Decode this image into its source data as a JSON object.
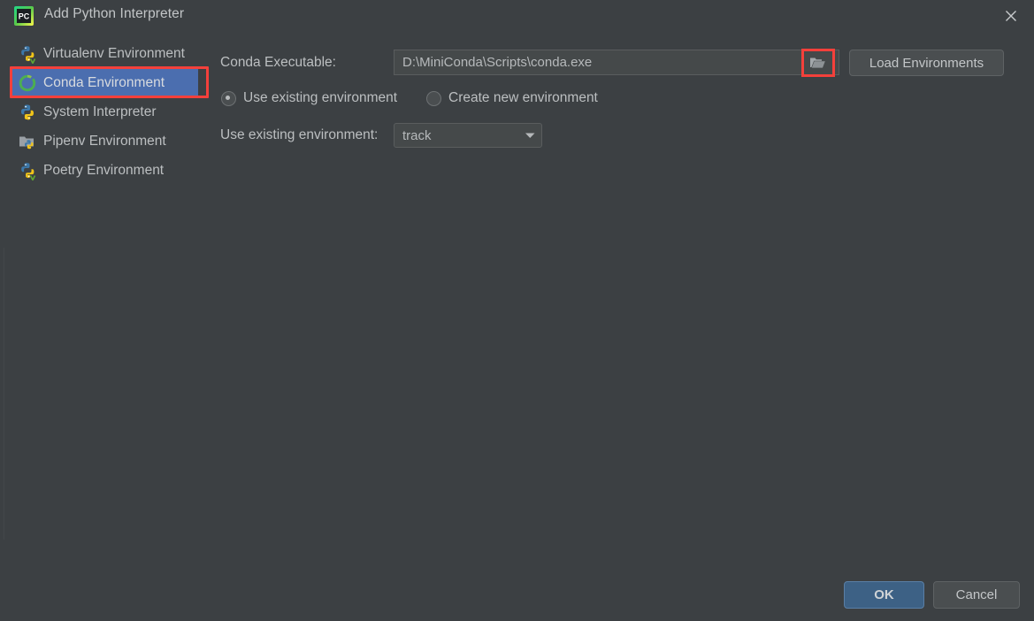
{
  "window": {
    "title": "Add Python Interpreter",
    "app_icon": "pycharm-icon",
    "close_icon": "close-icon"
  },
  "sidebar": {
    "items": [
      {
        "label": "Virtualenv Environment",
        "icon": "python-venv-icon",
        "selected": false
      },
      {
        "label": "Conda Environment",
        "icon": "conda-ring-icon",
        "selected": true
      },
      {
        "label": "System Interpreter",
        "icon": "python-icon",
        "selected": false
      },
      {
        "label": "Pipenv Environment",
        "icon": "folder-python-icon",
        "selected": false
      },
      {
        "label": "Poetry Environment",
        "icon": "python-venv-icon",
        "selected": false
      }
    ]
  },
  "main": {
    "conda_executable_label": "Conda Executable:",
    "conda_executable_value": "D:\\MiniConda\\Scripts\\conda.exe",
    "browse_icon": "folder-open-icon",
    "load_environments_label": "Load Environments",
    "radios": [
      {
        "label": "Use existing environment",
        "selected": true
      },
      {
        "label": "Create new environment",
        "selected": false
      }
    ],
    "use_existing_env_label": "Use existing environment:",
    "environment_value": "track",
    "environment_arrow_icon": "chevron-down-icon"
  },
  "footer": {
    "ok_label": "OK",
    "cancel_label": "Cancel"
  },
  "colors": {
    "background": "#3c4043",
    "selection_blue": "#4b6eaf",
    "highlight_red": "#f4403b",
    "ok_blue": "#3d6185",
    "conda_green": "#43b02a"
  }
}
